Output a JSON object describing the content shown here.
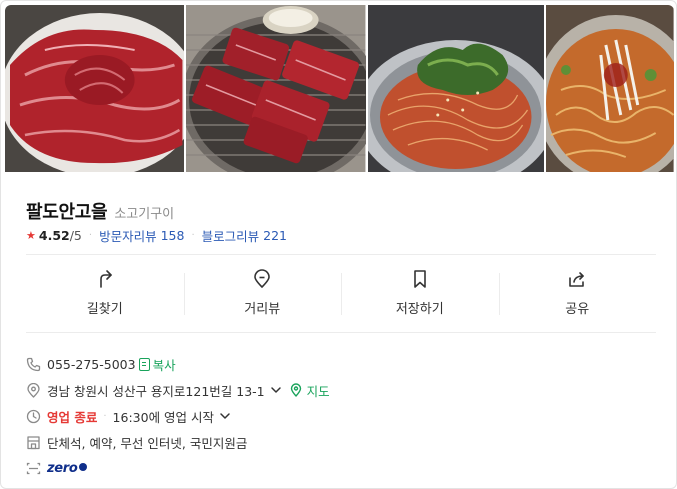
{
  "photos": [
    {
      "name": "raw-beef-platter-photo"
    },
    {
      "name": "grill-beef-photo"
    },
    {
      "name": "cold-noodles-photo"
    },
    {
      "name": "spicy-noodle-soup-photo"
    }
  ],
  "place": {
    "name": "팔도안고을",
    "category": "소고기구이"
  },
  "meta": {
    "rating": "4.52",
    "rating_max": "/5",
    "visitor_review_label": "방문자리뷰",
    "visitor_review_count": "158",
    "blog_review_label": "블로그리뷰",
    "blog_review_count": "221"
  },
  "actions": {
    "directions": "길찾기",
    "street_view": "거리뷰",
    "save": "저장하기",
    "share": "공유"
  },
  "info": {
    "phone": "055-275-5003",
    "copy_label": "복사",
    "address": "경남 창원시 성산구 용지로121번길 13-1",
    "map_label": "지도",
    "status": "영업 종료",
    "hours": "16:30에 영업 시작",
    "facilities": "단체석, 예약, 무선 인터넷, 국민지원금",
    "zero_pay": "zero"
  },
  "colors": {
    "accent_green": "#19a35b",
    "status_red": "#e53935",
    "link_blue": "#2c5bb5",
    "zeropay_navy": "#0f2e8a"
  }
}
